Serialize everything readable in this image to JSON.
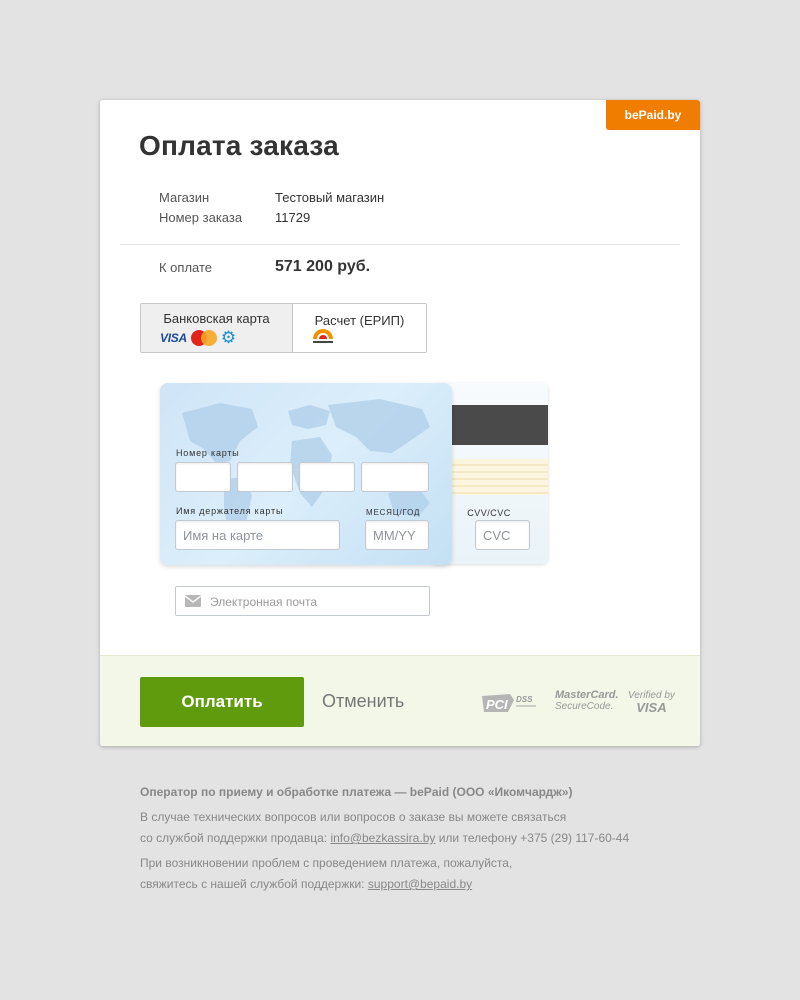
{
  "brand": {
    "badge": "bePaid.by"
  },
  "title": "Оплата заказа",
  "order": {
    "shop_label": "Магазин",
    "shop_value": "Тестовый магазин",
    "order_label": "Номер заказа",
    "order_value": "11729",
    "amount_label": "К оплате",
    "amount_value": "571 200 руб."
  },
  "tabs": [
    {
      "label": "Банковская карта",
      "active": true,
      "logos": [
        "visa-logo",
        "mastercard-logo",
        "belcard-gear-logo"
      ]
    },
    {
      "label": "Расчет (ЕРИП)",
      "active": false,
      "logos": [
        "raschet-logo"
      ]
    }
  ],
  "card_logos": {
    "visa": "VISA"
  },
  "card_form": {
    "number_label": "Номер карты",
    "holder_label": "Имя держателя карты",
    "holder_placeholder": "Имя на карте",
    "expiry_label": "МЕСЯЦ/ГОД",
    "expiry_placeholder": "ММ/YY",
    "cvv_label": "CVV/CVC",
    "cvv_placeholder": "CVC"
  },
  "email": {
    "placeholder": "Электронная почта",
    "icon": "envelope-icon"
  },
  "actions": {
    "pay_label": "Оплатить",
    "cancel_label": "Отменить"
  },
  "security_logos": {
    "pci": "PCI DSS",
    "mc_line1": "MasterCard.",
    "mc_line2": "SecureCode.",
    "vv_line1": "Verified by",
    "vv_line2": "VISA"
  },
  "footer": {
    "operator": "Оператор по приему и обработке платежа — bePaid (ООО «Икомчардж»)",
    "support_text_1": "В случае технических вопросов или вопросов о заказе вы можете связаться",
    "support_text_2": "со службой поддержки продавца:",
    "merchant_email": "info@bezkassira.by",
    "support_text_3": "или телефону +375 (29) 117-60-44",
    "problem_text_1": "При возникновении проблем с проведением платежа, пожалуйста,",
    "problem_text_2": "свяжитесь с нашей службой поддержки:",
    "support_email": "support@bepaid.by"
  },
  "colors": {
    "background": "#e3e3e3",
    "brand_orange": "#f07c00",
    "pay_green": "#5f9b0c",
    "footer_bar": "#f3f7e7"
  }
}
